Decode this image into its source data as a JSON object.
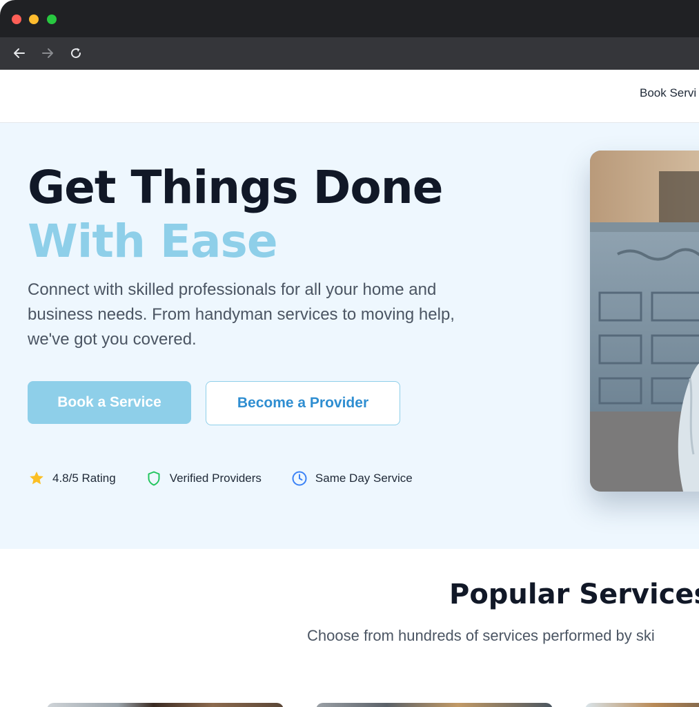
{
  "browser": {
    "controls": {
      "close": "close-window",
      "minimize": "minimize-window",
      "maximize": "maximize-window"
    },
    "nav": {
      "back_icon": "arrow-left-icon",
      "forward_icon": "arrow-right-icon",
      "reload_icon": "reload-icon"
    }
  },
  "header": {
    "nav_link": "Book Servi"
  },
  "hero": {
    "title_line1": "Get Things Done",
    "title_line2": "With Ease",
    "description": "Connect with skilled professionals for all your home and business needs. From handyman services to moving help, we've got you covered.",
    "primary_button": "Book a Service",
    "secondary_button": "Become a Provider",
    "features": [
      {
        "icon": "star-icon",
        "label": "4.8/5 Rating"
      },
      {
        "icon": "shield-icon",
        "label": "Verified Providers"
      },
      {
        "icon": "clock-icon",
        "label": "Same Day Service"
      }
    ]
  },
  "services": {
    "title": "Popular Services",
    "subtitle": "Choose from hundreds of services performed by ski"
  },
  "colors": {
    "accent": "#8ecfe9",
    "link_blue": "#2f8ed1",
    "hero_bg": "#eef7fe",
    "heading": "#111827",
    "star": "#fbbf24",
    "shield": "#22c55e",
    "clock": "#3b82f6"
  }
}
